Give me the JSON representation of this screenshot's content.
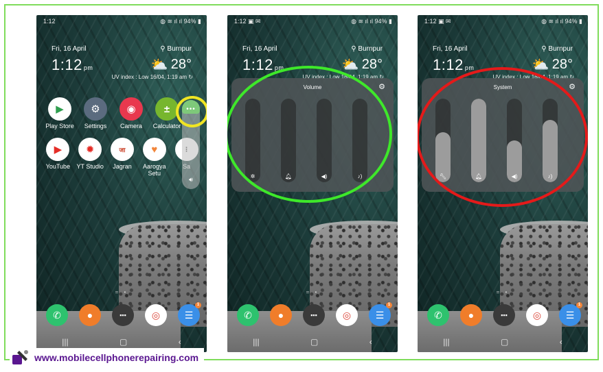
{
  "status_bar": {
    "time": "1:12",
    "battery": "94%"
  },
  "lockscreen": {
    "date": "Fri, 16 April",
    "time": "1:12",
    "ampm": "pm",
    "location": "Burnpur",
    "temperature": "28°",
    "uv": "UV index : Low",
    "updated": "16/04, 1:19 am"
  },
  "apps_row1": [
    {
      "label": "Play Store",
      "icon": "play-store-icon",
      "color": "#ffffff"
    },
    {
      "label": "Settings",
      "icon": "settings-icon",
      "color": "#5b6b7f"
    },
    {
      "label": "Camera",
      "icon": "camera-icon",
      "color": "#e9384e"
    },
    {
      "label": "Calculator",
      "icon": "calculator-icon",
      "color": "#77b62e"
    }
  ],
  "apps_row2": [
    {
      "label": "YouTube",
      "icon": "youtube-icon",
      "color": "#ffffff"
    },
    {
      "label": "YT Studio",
      "icon": "yt-studio-icon",
      "color": "#ffffff"
    },
    {
      "label": "Jagran",
      "icon": "jagran-icon",
      "color": "#ffffff"
    },
    {
      "label": "Aarogya Setu",
      "icon": "aarogya-setu-icon",
      "color": "#ffffff"
    },
    {
      "label": "Sa",
      "icon": "samsung-app-icon",
      "color": "#ffffff"
    }
  ],
  "panels": [
    {
      "title": "Volume",
      "sliders": [
        {
          "icon": "accessibility-icon",
          "level": 0
        },
        {
          "icon": "bell-icon",
          "level": 0
        },
        {
          "icon": "speaker-icon",
          "level": 0
        },
        {
          "icon": "media-volume-icon",
          "level": 0
        }
      ]
    },
    {
      "title": "System",
      "sliders": [
        {
          "icon": "wrench-icon",
          "level": 0.6
        },
        {
          "icon": "bell-icon",
          "level": 1.0
        },
        {
          "icon": "speaker-icon",
          "level": 0.5
        },
        {
          "icon": "media-volume-icon",
          "level": 0.75
        }
      ]
    }
  ],
  "dock": [
    {
      "icon": "phone-icon",
      "color": "#2ec26e"
    },
    {
      "icon": "contacts-icon",
      "color": "#f07d2a"
    },
    {
      "icon": "app-folder-icon",
      "color": "#3a3a3a"
    },
    {
      "icon": "chrome-icon",
      "color": "#ffffff"
    },
    {
      "icon": "messages-icon",
      "color": "#3a8fe8",
      "badge": "1"
    }
  ],
  "footer": {
    "url": "www.mobilecellphonerepairing.com"
  },
  "colors": {
    "frame": "#7fdc5a",
    "highlight_yellow": "#f0e523",
    "highlight_green": "#3ee82a",
    "highlight_red": "#e41a1a"
  }
}
